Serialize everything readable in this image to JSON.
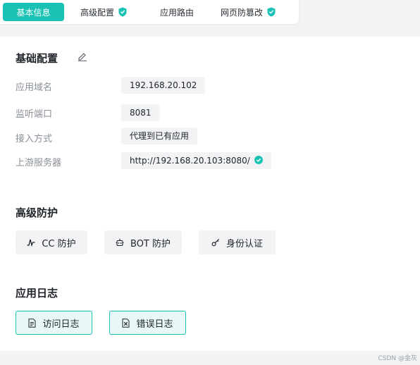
{
  "tabs": [
    {
      "label": "基本信息",
      "active": true
    },
    {
      "label": "高级配置",
      "icon": "shield-icon"
    },
    {
      "label": "应用路由"
    },
    {
      "label": "网页防篡改",
      "icon": "shield-icon"
    }
  ],
  "basic": {
    "title": "基础配置",
    "rows": [
      {
        "label": "应用域名",
        "value": "192.168.20.102"
      },
      {
        "label": "监听端口",
        "value": "8081"
      },
      {
        "label": "接入方式",
        "value": "代理到已有应用"
      },
      {
        "label": "上游服务器",
        "value": "http://192.168.20.103:8080/"
      }
    ]
  },
  "advanced": {
    "title": "高级防护",
    "buttons": [
      {
        "label": "CC 防护",
        "icon": "pulse-icon"
      },
      {
        "label": "BOT 防护",
        "icon": "robot-icon"
      },
      {
        "label": "身份认证",
        "icon": "key-icon"
      }
    ]
  },
  "logs": {
    "title": "应用日志",
    "buttons": [
      {
        "label": "访问日志",
        "icon": "log-file-icon"
      },
      {
        "label": "错误日志",
        "icon": "error-file-icon"
      }
    ]
  },
  "watermark": "CSDN @金灰",
  "colors": {
    "accent": "#19c2b4",
    "muted": "#8a8f98",
    "pill_bg": "#f2f3f5"
  }
}
